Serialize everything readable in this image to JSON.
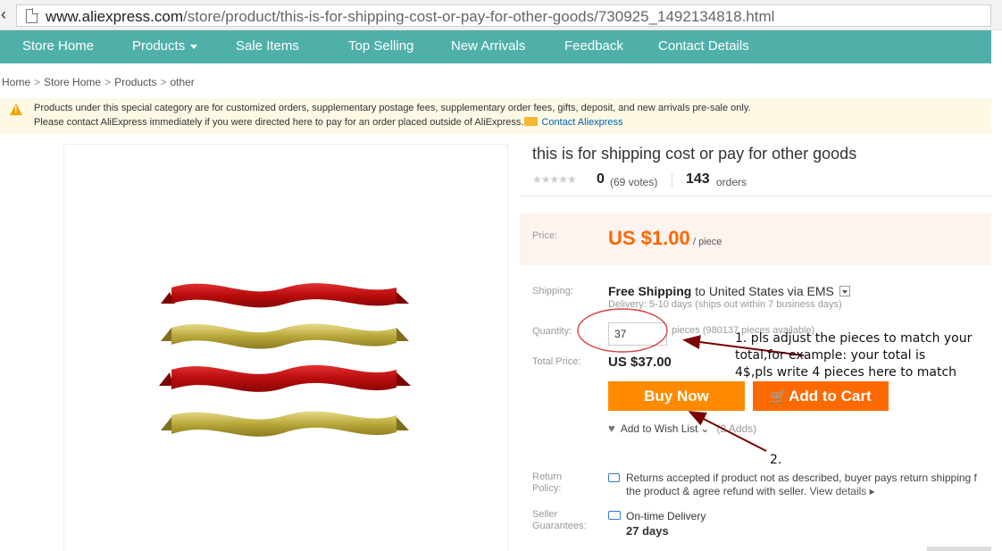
{
  "browser": {
    "url_host": "www.aliexpress.com",
    "url_path": "/store/product/this-is-for-shipping-cost-or-pay-for-other-goods/730925_1492134818.html"
  },
  "nav": {
    "items": [
      "Store Home",
      "Products",
      "Sale Items",
      "Top Selling",
      "New Arrivals",
      "Feedback",
      "Contact Details"
    ]
  },
  "breadcrumb": {
    "items": [
      "Home",
      "Store Home",
      "Products",
      "other"
    ]
  },
  "notice": {
    "line1": "Products under this special category are for customized orders, supplementary postage fees, supplementary order fees, gifts, deposit, and new arrivals pre-sale only.",
    "line2": "Please contact AliExpress immediately if you were directed here to pay for an order placed outside of AliExpress.",
    "link": "Contact Aliexpress"
  },
  "product": {
    "title": "this is for shipping cost or pay for other goods",
    "rating": "0",
    "votes": "(69 votes)",
    "orders_count": "143",
    "orders_label": "orders",
    "price_label": "Price:",
    "price": "US $1.00",
    "price_unit": "/ piece",
    "shipping_label": "Shipping:",
    "shipping_free": "Free Shipping",
    "shipping_to": "to",
    "shipping_dest": "United States via EMS",
    "delivery": "Delivery: 5-10 days (ships out within 7 business days)",
    "quantity_label": "Quantity:",
    "quantity_value": "37",
    "quantity_after": "pieces (980137 pieces available)",
    "total_label": "Total Price:",
    "total_value": "US $37.00",
    "buy_now": "Buy Now",
    "add_to_cart": "Add to Cart",
    "wishlist": "Add to Wish List",
    "wishlist_count": "(2 Adds)",
    "return_label_1": "Return",
    "return_label_2": "Policy:",
    "return_line1": "Returns accepted if product not as described, buyer pays return shipping f",
    "return_line2": "the product & agree refund with seller.",
    "return_link": "View details",
    "seller_label_1": "Seller",
    "seller_label_2": "Guarantees:",
    "seller_line1": "On-time Delivery",
    "seller_line2": "27 days"
  },
  "annotation": {
    "note1_line1": "1. pls adjust the pieces to match your",
    "note1_line2": "total,for example: your total is",
    "note1_line3": "4$,pls write 4 pieces here to match",
    "note2": "2."
  },
  "colors": {
    "nav_bg": "#4fb0aa",
    "price": "#ff6600",
    "buy_now": "#ff8a00",
    "add_to_cart": "#ff6a00",
    "ribbon_red": "#cc1111",
    "ribbon_gold": "#c9b84a",
    "annotation_arrow": "#7a0000"
  }
}
